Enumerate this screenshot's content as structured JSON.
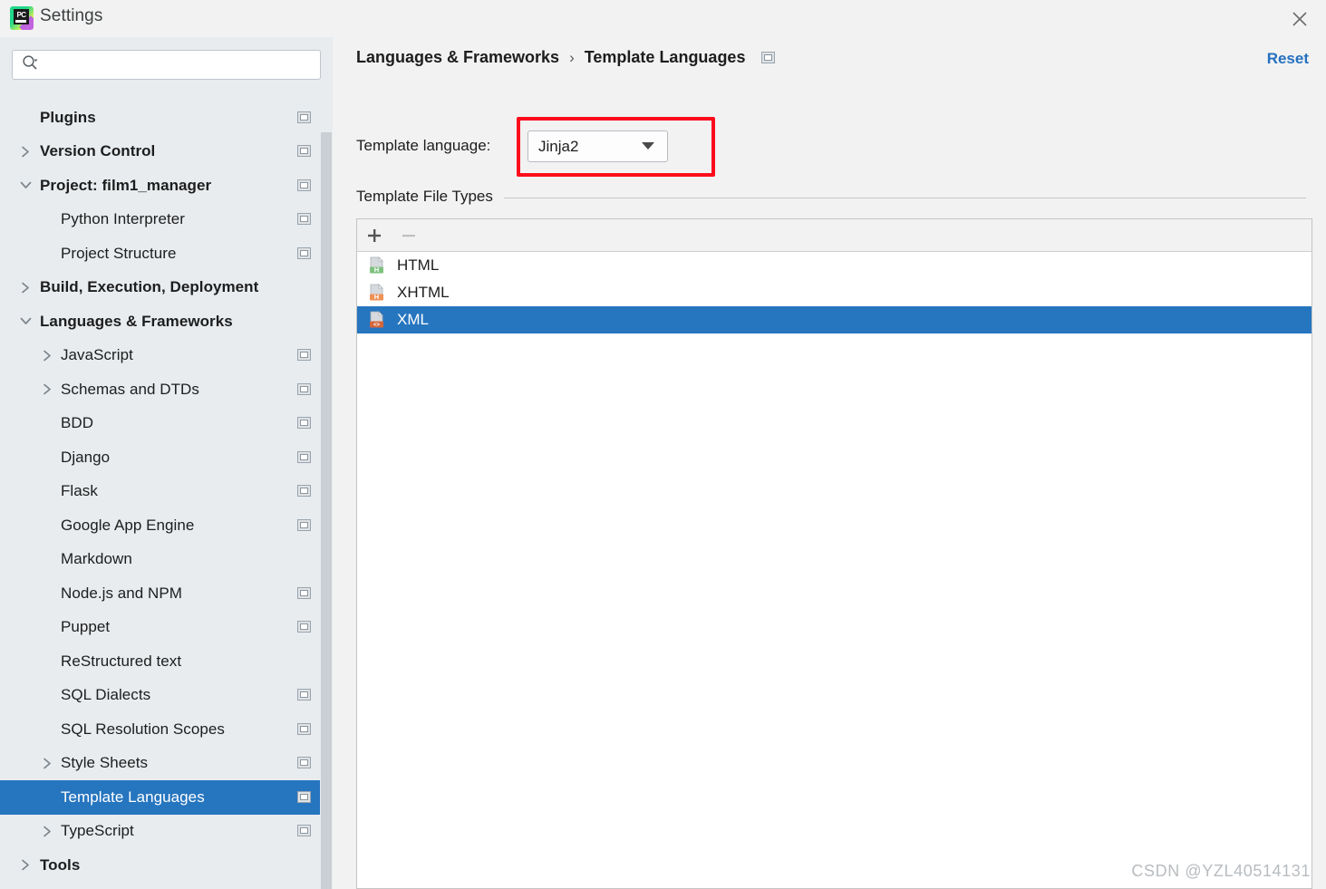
{
  "window": {
    "title": "Settings",
    "logo_icon": "pycharm-logo-icon",
    "close_icon": "close-icon"
  },
  "search": {
    "icon": "search-icon",
    "value": "",
    "placeholder": ""
  },
  "sidebar": {
    "clipped_item_above": "",
    "items": [
      {
        "label": "Plugins",
        "level": 0,
        "bold": true,
        "arrow": "none",
        "badge": true,
        "selected": false
      },
      {
        "label": "Version Control",
        "level": 0,
        "bold": true,
        "arrow": "right",
        "badge": true,
        "selected": false
      },
      {
        "label": "Project: film1_manager",
        "level": 0,
        "bold": true,
        "arrow": "down",
        "badge": true,
        "selected": false
      },
      {
        "label": "Python Interpreter",
        "level": 1,
        "bold": false,
        "arrow": "none",
        "badge": true,
        "selected": false
      },
      {
        "label": "Project Structure",
        "level": 1,
        "bold": false,
        "arrow": "none",
        "badge": true,
        "selected": false
      },
      {
        "label": "Build, Execution, Deployment",
        "level": 0,
        "bold": true,
        "arrow": "right",
        "badge": false,
        "selected": false
      },
      {
        "label": "Languages & Frameworks",
        "level": 0,
        "bold": true,
        "arrow": "down",
        "badge": false,
        "selected": false
      },
      {
        "label": "JavaScript",
        "level": 1,
        "bold": false,
        "arrow": "right",
        "badge": true,
        "selected": false
      },
      {
        "label": "Schemas and DTDs",
        "level": 1,
        "bold": false,
        "arrow": "right",
        "badge": true,
        "selected": false
      },
      {
        "label": "BDD",
        "level": 1,
        "bold": false,
        "arrow": "none",
        "badge": true,
        "selected": false
      },
      {
        "label": "Django",
        "level": 1,
        "bold": false,
        "arrow": "none",
        "badge": true,
        "selected": false
      },
      {
        "label": "Flask",
        "level": 1,
        "bold": false,
        "arrow": "none",
        "badge": true,
        "selected": false
      },
      {
        "label": "Google App Engine",
        "level": 1,
        "bold": false,
        "arrow": "none",
        "badge": true,
        "selected": false
      },
      {
        "label": "Markdown",
        "level": 1,
        "bold": false,
        "arrow": "none",
        "badge": false,
        "selected": false
      },
      {
        "label": "Node.js and NPM",
        "level": 1,
        "bold": false,
        "arrow": "none",
        "badge": true,
        "selected": false
      },
      {
        "label": "Puppet",
        "level": 1,
        "bold": false,
        "arrow": "none",
        "badge": true,
        "selected": false
      },
      {
        "label": "ReStructured text",
        "level": 1,
        "bold": false,
        "arrow": "none",
        "badge": false,
        "selected": false
      },
      {
        "label": "SQL Dialects",
        "level": 1,
        "bold": false,
        "arrow": "none",
        "badge": true,
        "selected": false
      },
      {
        "label": "SQL Resolution Scopes",
        "level": 1,
        "bold": false,
        "arrow": "none",
        "badge": true,
        "selected": false
      },
      {
        "label": "Style Sheets",
        "level": 1,
        "bold": false,
        "arrow": "right",
        "badge": true,
        "selected": false
      },
      {
        "label": "Template Languages",
        "level": 1,
        "bold": false,
        "arrow": "none",
        "badge": true,
        "selected": true
      },
      {
        "label": "TypeScript",
        "level": 1,
        "bold": false,
        "arrow": "right",
        "badge": true,
        "selected": false
      },
      {
        "label": "Tools",
        "level": 0,
        "bold": true,
        "arrow": "right",
        "badge": false,
        "selected": false
      }
    ]
  },
  "header": {
    "breadcrumb_parent": "Languages & Frameworks",
    "breadcrumb_separator": "›",
    "breadcrumb_current": "Template Languages",
    "breadcrumb_badge_icon": "settings-window-icon",
    "reset_label": "Reset"
  },
  "main": {
    "template_language_label": "Template language:",
    "template_language_value": "Jinja2",
    "combo_arrow_icon": "chevron-down-icon",
    "section_title": "Template File Types",
    "toolbar": {
      "add_label": "+",
      "add_icon": "plus-icon",
      "remove_label": "−",
      "remove_icon": "minus-icon",
      "remove_disabled": true
    },
    "file_types": [
      {
        "label": "HTML",
        "icon": "html-file-icon",
        "badge_text": "H",
        "badge_color": "#7fc17f",
        "selected": false
      },
      {
        "label": "XHTML",
        "icon": "xhtml-file-icon",
        "badge_text": "H",
        "badge_color": "#ef9055",
        "selected": false
      },
      {
        "label": "XML",
        "icon": "xml-file-icon",
        "badge_text": "<>",
        "badge_color": "#d4663c",
        "selected": true
      }
    ]
  },
  "watermark": "CSDN @YZL40514131",
  "colors": {
    "accent_selection": "#2675bf",
    "link": "#2470c0",
    "annotation_red": "#fc0d1c",
    "sidebar_bg": "#e8ecef",
    "content_bg": "#f2f2f2"
  }
}
